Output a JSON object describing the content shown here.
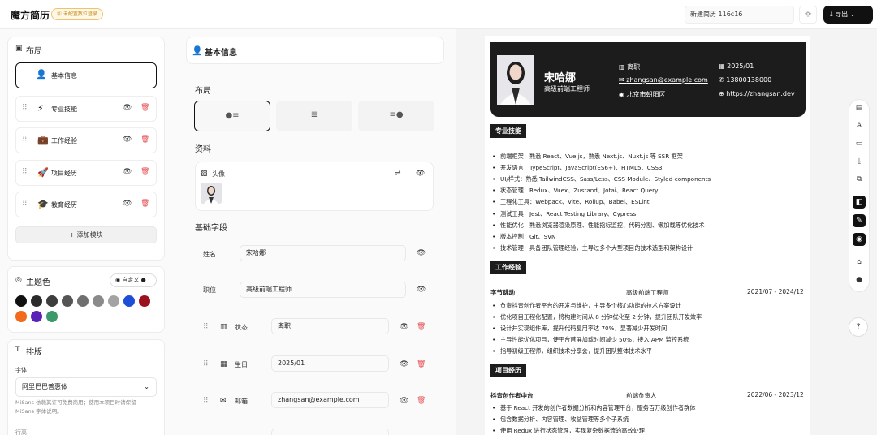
{
  "header": {
    "logo": "魔方简历",
    "login_badge": "⓪ 未配置数位登录",
    "resume_name": "新建简历 116c16",
    "theme_icon": "sun-icon",
    "export_label": "导出"
  },
  "layout_panel": {
    "title": "布局",
    "modules": [
      {
        "label": "基本信息",
        "icon": "person-icon"
      },
      {
        "label": "专业技能",
        "icon": "lightning-icon"
      },
      {
        "label": "工作经验",
        "icon": "briefcase-icon"
      },
      {
        "label": "项目经历",
        "icon": "rocket-icon"
      },
      {
        "label": "教育经历",
        "icon": "graduation-cap-icon"
      }
    ],
    "add_label": "添加模块"
  },
  "theme": {
    "title": "主题色",
    "custom_label": "自定义",
    "colors": [
      "#111111",
      "#2b2b2b",
      "#3d3d3d",
      "#555555",
      "#6f6f6f",
      "#8a8a8a",
      "#a3a3a3",
      "#1d4ed8",
      "#9b111e",
      "#f26b1d",
      "#5b21b6",
      "#3a9a6a"
    ]
  },
  "typography": {
    "title": "排版",
    "font_label": "字体",
    "font_value": "阿里巴巴普惠体",
    "hint": "MiSans 依赖其许可免费商用；使用本项目时请保留 MiSans 字体说明。",
    "cut_label": "行高"
  },
  "editor": {
    "title": "基本信息",
    "layout_label": "布局",
    "profile_label": "资料",
    "avatar_label": "头像",
    "base_fields_label": "基础字段",
    "fields": [
      {
        "label": "姓名",
        "value": "宋哈娜"
      },
      {
        "label": "职位",
        "value": "高级前端工程师"
      },
      {
        "label": "状态",
        "value": "离职"
      },
      {
        "label": "生日",
        "value": "2025/01"
      },
      {
        "label": "邮箱",
        "value": "zhangsan@example.com"
      }
    ]
  },
  "resume": {
    "name": "宋哈娜",
    "title": "高级前端工程师",
    "status": "离职",
    "birthday": "2025/01",
    "email": "zhangsan@example.com",
    "phone": "13800138000",
    "location": "北京市朝阳区",
    "site": "https://zhangsan.dev",
    "skills_title": "专业技能",
    "skills": [
      "前端框架：熟悉 React、Vue.js，熟悉 Next.js、Nuxt.js 等 SSR 框架",
      "开发语言：TypeScript、JavaScript(ES6+)、HTML5、CSS3",
      "UI/样式：熟悉 TailwindCSS、Sass/Less、CSS Module、Styled-components",
      "状态管理：Redux、Vuex、Zustand、Jotai、React Query",
      "工程化工具：Webpack、Vite、Rollup、Babel、ESLint",
      "测试工具：Jest、React Testing Library、Cypress",
      "性能优化：熟悉浏览器渲染原理、性能指标监控、代码分割、懒加载等优化技术",
      "版本控制：Git、SVN",
      "技术管理：具备团队管理经验，主导过多个大型项目的技术选型和架构设计"
    ],
    "work_title": "工作经验",
    "work": {
      "company": "字节跳动",
      "role": "高级前端工程师",
      "period": "2021/07 - 2024/12",
      "items": [
        "负责抖音创作者平台的开发与维护，主导多个核心功能的技术方案设计",
        "优化项目工程化配置，将构建时间从 8 分钟优化至 2 分钟，提升团队开发效率",
        "设计并实现组件库，提升代码复用率达 70%，显著减少开发时间",
        "主导性能优化项目，使平台首屏加载时间减少 50%，接入 APM 监控系统",
        "指导初级工程师，组织技术分享会，提升团队整体技术水平"
      ]
    },
    "project_title": "项目经历",
    "project": {
      "name": "抖音创作者中台",
      "role": "前端负责人",
      "period": "2022/06 - 2023/12",
      "items": [
        "基于 React 开发的创作者数据分析和内容管理平台，服务百万级创作者群体",
        "包含数据分析、内容管理、收益管理等多个子系统",
        "使用 Redux 进行状态管理，实现复杂数据流的高效处理"
      ]
    }
  }
}
